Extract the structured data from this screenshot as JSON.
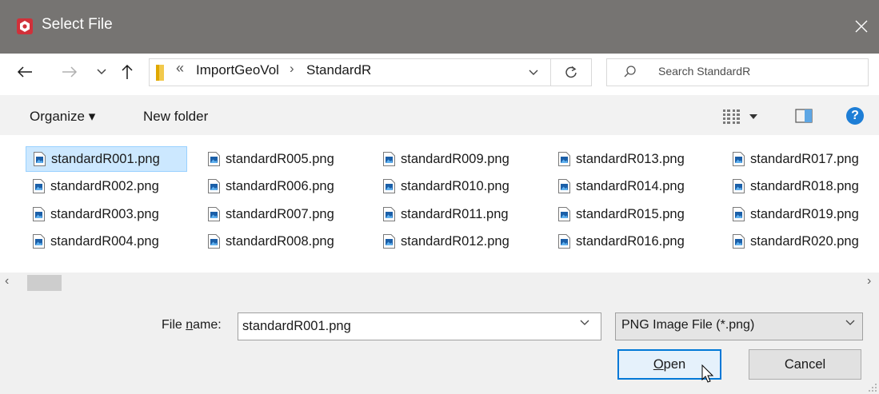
{
  "window": {
    "title": "Select File",
    "close_glyph": "✕"
  },
  "nav": {
    "back_glyph": "←",
    "forward_glyph": "→",
    "recent_glyph": "⌄",
    "up_glyph": "↑",
    "breadcrumb_overflow": "«",
    "breadcrumbs": [
      "ImportGeoVol",
      "StandardR"
    ],
    "crumb_sep": "›",
    "refresh_glyph": "↻",
    "search_placeholder": "Search StandardR"
  },
  "toolbar": {
    "organize_label": "Organize ▾",
    "new_folder_label": "New folder",
    "help_label": "?"
  },
  "files": [
    "standardR001.png",
    "standardR002.png",
    "standardR003.png",
    "standardR004.png",
    "standardR005.png",
    "standardR006.png",
    "standardR007.png",
    "standardR008.png",
    "standardR009.png",
    "standardR010.png",
    "standardR011.png",
    "standardR012.png",
    "standardR013.png",
    "standardR014.png",
    "standardR015.png",
    "standardR016.png",
    "standardR017.png",
    "standardR018.png",
    "standardR019.png",
    "standardR020.png"
  ],
  "selected_file": "standardR001.png",
  "scrollbar": {
    "left_glyph": "‹",
    "right_glyph": "›"
  },
  "footer": {
    "file_name_label_pre": "File ",
    "file_name_label_underlined": "n",
    "file_name_label_post": "ame:",
    "file_name_value": "standardR001.png",
    "file_type_value": "PNG Image File (*.png)",
    "open_label_underlined": "O",
    "open_label_rest": "pen",
    "cancel_label": "Cancel"
  },
  "colors": {
    "titlebar": "#767472",
    "selection": "#cce8ff",
    "accent": "#0078d7",
    "logo": "#d0313a"
  }
}
